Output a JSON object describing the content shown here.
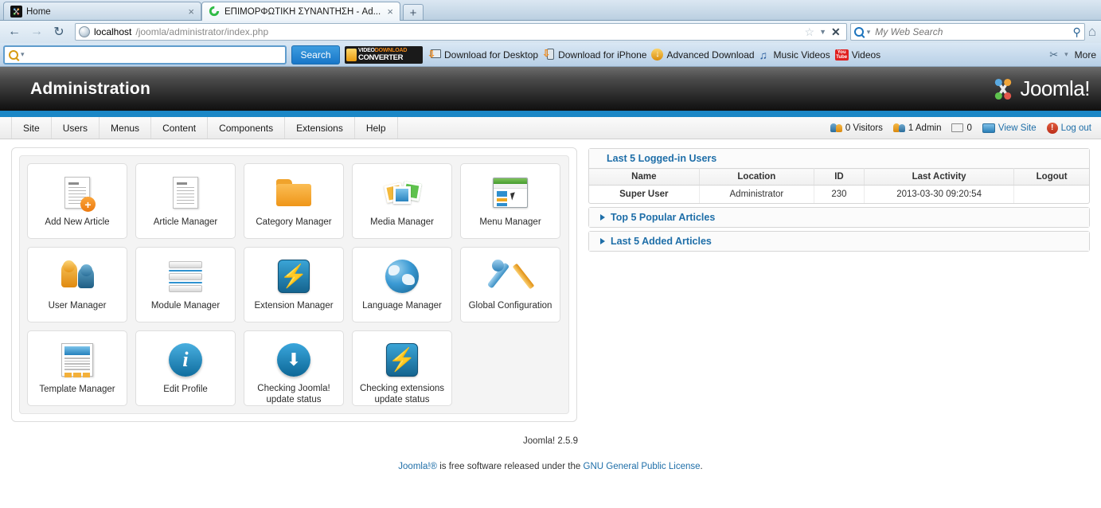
{
  "browser": {
    "tabs": [
      {
        "title": "Home",
        "favicon": "joomla-favicon",
        "active": false,
        "close_label": "×"
      },
      {
        "title": "ΕΠΙΜΟΡΦΩΤΙΚΗ ΣΥΝΑΝΤΗΣΗ - Ad...",
        "favicon": "loading-spinner",
        "active": true,
        "close_label": "×"
      }
    ],
    "new_tab_label": "+",
    "nav": {
      "back": "←",
      "forward": "→",
      "reload": "↻"
    },
    "url": {
      "host": "localhost",
      "path": "/joomla/administrator/index.php",
      "star": "☆",
      "dropdown": "▼",
      "stop": "✕"
    },
    "web_search": {
      "placeholder": "My Web Search",
      "value": "",
      "go": "⚲"
    },
    "home_icon": "⌂",
    "addon_toolbar": {
      "search_value": "",
      "search_button": "Search",
      "vdc_line1a": "VIDEO",
      "vdc_line1b": "DOWNLOAD",
      "vdc_line2": "CONVERTER",
      "links": [
        {
          "label": "Download for Desktop",
          "icon": "monitor-download-icon"
        },
        {
          "label": "Download for iPhone",
          "icon": "phone-download-icon"
        },
        {
          "label": "Advanced Download",
          "icon": "advanced-download-icon"
        },
        {
          "label": "Music Videos",
          "icon": "music-note-icon"
        },
        {
          "label": "Videos",
          "icon": "youtube-icon"
        }
      ],
      "youtube_l1": "You",
      "youtube_l2": "Tube",
      "tools_icon": "✂",
      "tools_caret": "▾",
      "more_label": "More"
    }
  },
  "joomla": {
    "header_title": "Administration",
    "logo_text": "Joomla!",
    "accent_blue": "#1b87c6",
    "menu": [
      {
        "label": "Site"
      },
      {
        "label": "Users"
      },
      {
        "label": "Menus"
      },
      {
        "label": "Content"
      },
      {
        "label": "Components"
      },
      {
        "label": "Extensions"
      },
      {
        "label": "Help"
      }
    ],
    "status_items": [
      {
        "label": "0 Visitors",
        "icon": "visitors-icon",
        "link": false
      },
      {
        "label": "1 Admin",
        "icon": "admin-icon",
        "link": false
      },
      {
        "label": "0",
        "icon": "messages-icon",
        "link": false
      },
      {
        "label": "View Site",
        "icon": "view-site-icon",
        "link": true
      },
      {
        "label": "Log out",
        "icon": "logout-icon",
        "link": true
      }
    ],
    "tiles": [
      {
        "label": "Add New Article",
        "icon": "add-article-icon"
      },
      {
        "label": "Article Manager",
        "icon": "article-manager-icon"
      },
      {
        "label": "Category Manager",
        "icon": "folder-icon"
      },
      {
        "label": "Media Manager",
        "icon": "media-icon"
      },
      {
        "label": "Menu Manager",
        "icon": "menu-window-icon"
      },
      {
        "label": "User Manager",
        "icon": "users-icon"
      },
      {
        "label": "Module Manager",
        "icon": "modules-icon"
      },
      {
        "label": "Extension Manager",
        "icon": "extension-bolt-icon"
      },
      {
        "label": "Language Manager",
        "icon": "globe-icon"
      },
      {
        "label": "Global Configuration",
        "icon": "tools-icon"
      },
      {
        "label": "Template Manager",
        "icon": "template-icon"
      },
      {
        "label": "Edit Profile",
        "icon": "info-icon"
      },
      {
        "label": "Checking Joomla! update status",
        "icon": "download-arrow-icon"
      },
      {
        "label": "Checking extensions update status",
        "icon": "extension-bolt-icon"
      }
    ],
    "panels": {
      "logged_in_users": {
        "title": "Last 5 Logged-in Users",
        "columns": [
          "Name",
          "Location",
          "ID",
          "Last Activity",
          "Logout"
        ],
        "rows": [
          {
            "name": "Super User",
            "location": "Administrator",
            "id": "230",
            "last_activity": "2013-03-30 09:20:54",
            "logout": ""
          }
        ]
      },
      "popular_articles": {
        "title": "Top 5 Popular Articles"
      },
      "added_articles": {
        "title": "Last 5 Added Articles"
      }
    },
    "footer": {
      "version": "Joomla! 2.5.9",
      "license_prefix": "Joomla!®",
      "license_mid": " is free software released under the ",
      "license_link": "GNU General Public License",
      "license_suffix": "."
    }
  }
}
